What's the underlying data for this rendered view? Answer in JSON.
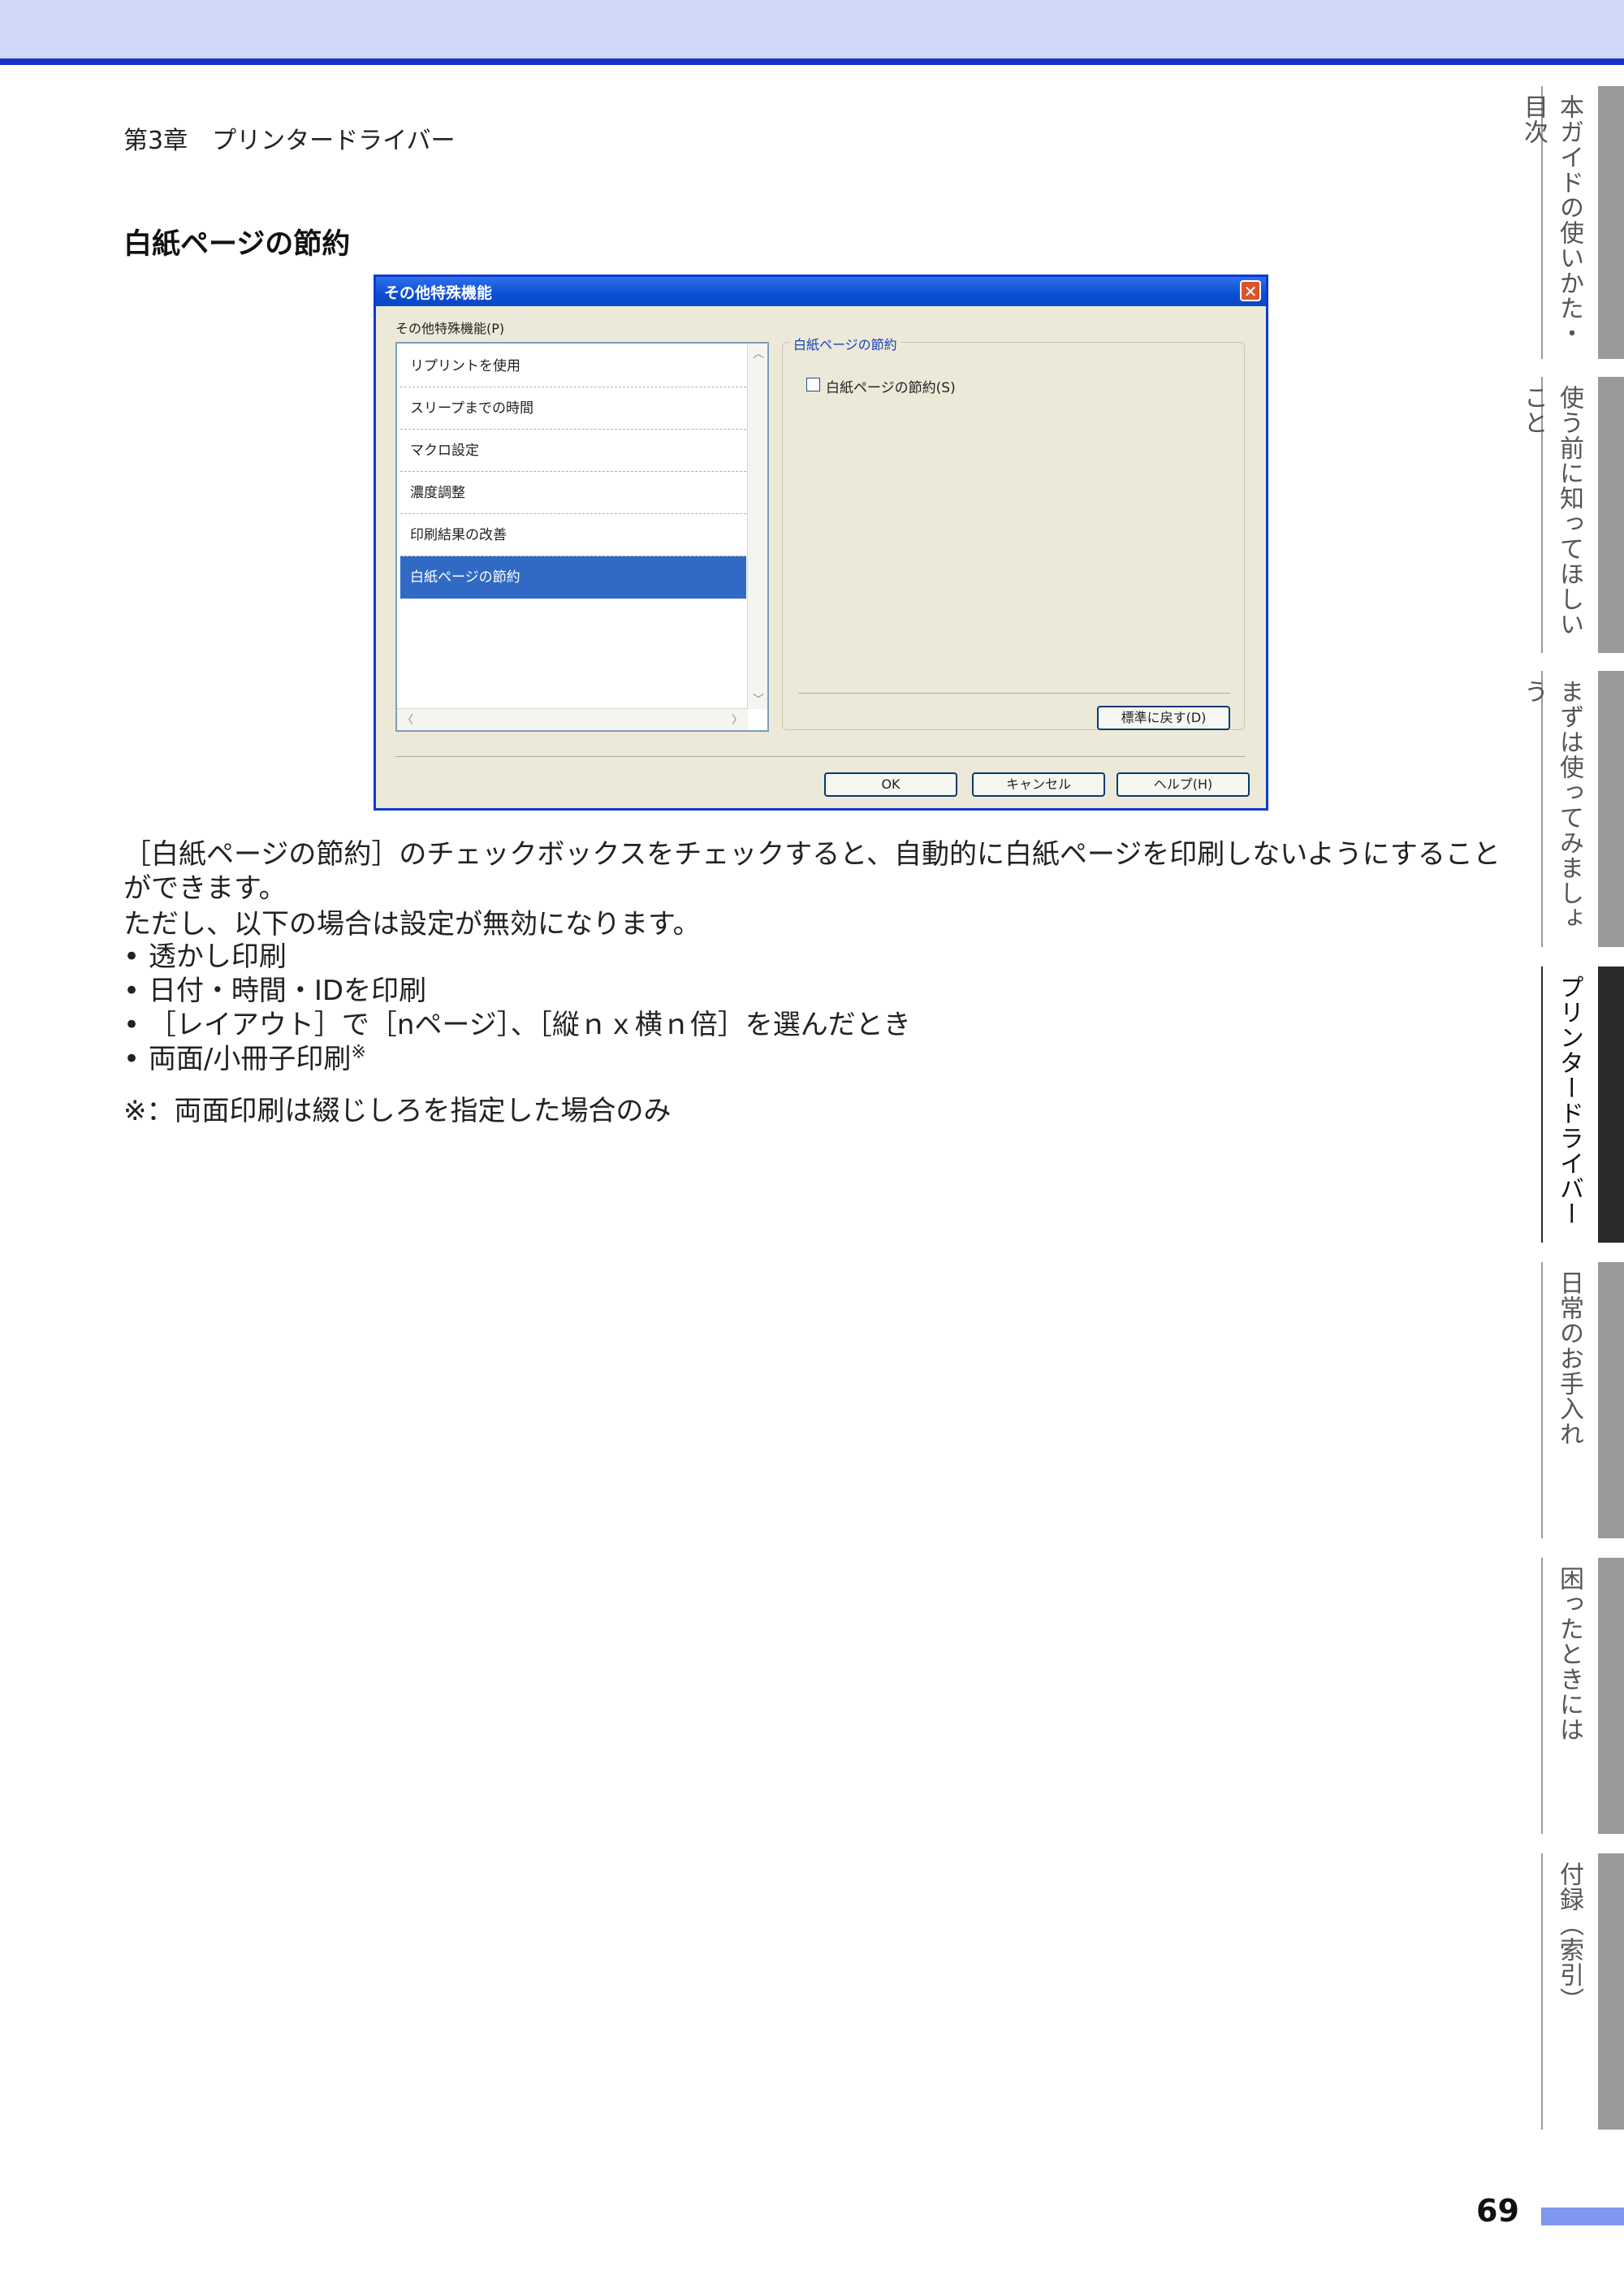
{
  "header": {
    "chapter": "第3章　プリンタードライバー"
  },
  "section": {
    "title": "白紙ページの節約"
  },
  "dialog": {
    "title": "その他特殊機能",
    "list_label": "その他特殊機能(P)",
    "items": [
      {
        "label": "リプリントを使用"
      },
      {
        "label": "スリープまでの時間"
      },
      {
        "label": "マクロ設定"
      },
      {
        "label": "濃度調整"
      },
      {
        "label": "印刷結果の改善"
      },
      {
        "label": "白紙ページの節約"
      }
    ],
    "selected_index": 5,
    "group_title": "白紙ページの節約",
    "checkbox_label": "白紙ページの節約(S)",
    "checkbox_checked": false,
    "reset_button": "標準に戻す(D)",
    "ok_button": "OK",
    "cancel_button": "キャンセル",
    "help_button": "ヘルプ(H)"
  },
  "body": {
    "para1_line1": "［白紙ページの節約］のチェックボックスをチェックすると、自動的に白紙ページを印刷しないようにすること",
    "para1_line2": "ができます。",
    "para2": "ただし、以下の場合は設定が無効になります。",
    "bullets": [
      "透かし印刷",
      "日付・時間・IDを印刷",
      "［レイアウト］で［nページ］、［縦ｎｘ横ｎ倍］を選んだとき",
      "両面/小冊子印刷"
    ],
    "note_mark": "※",
    "footnote": "※：両面印刷は綴じしろを指定した場合のみ"
  },
  "side_tabs": [
    {
      "label": "本ガイドの使いかた・目次"
    },
    {
      "label": "使う前に知ってほしいこと"
    },
    {
      "label": "まずは使ってみましょう"
    },
    {
      "label": "プリンタードライバー"
    },
    {
      "label": "日常のお手入れ"
    },
    {
      "label": "困ったときには"
    },
    {
      "label": "付録（索引）"
    }
  ],
  "active_tab_index": 3,
  "page_number": "69",
  "colors": {
    "top_band": "#cfd8f8",
    "top_rule": "#1733c9",
    "page_bar": "#7f97ee",
    "active_tab": "#2a2a2a",
    "tab_gray": "#9a9a9a",
    "selection": "#316ac5"
  }
}
